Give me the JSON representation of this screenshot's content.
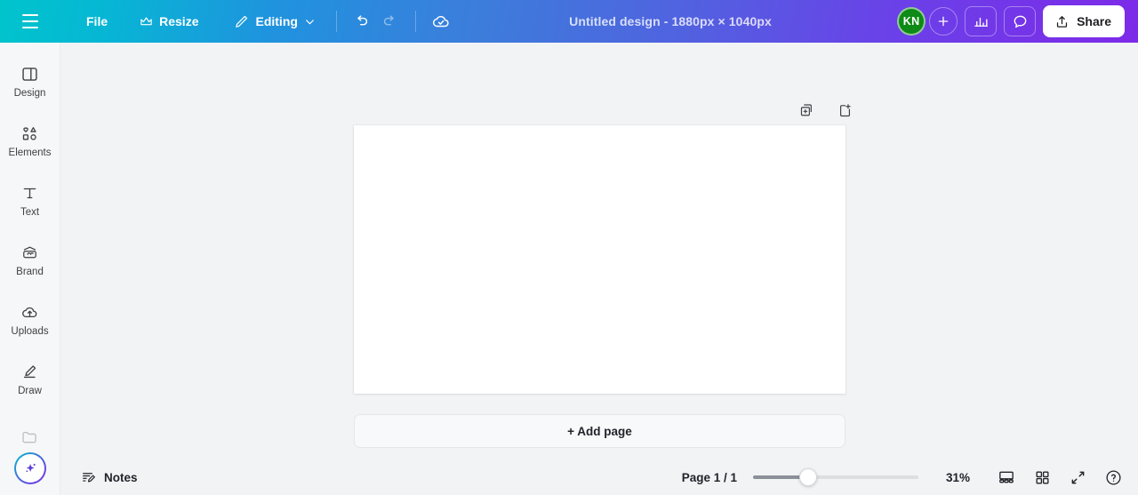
{
  "topbar": {
    "menu_icon": "hamburger-icon",
    "file_label": "File",
    "resize_label": "Resize",
    "resize_icon": "crown-icon",
    "editing_label": "Editing",
    "editing_icon": "pencil-icon",
    "editing_chevron": "chevron-down-icon",
    "undo_icon": "undo-icon",
    "redo_icon": "redo-icon",
    "saved_icon": "cloud-check-icon",
    "title": "Untitled design - 1880px × 1040px",
    "avatar_initials": "KN",
    "avatar_color": "#0e8a16",
    "add_collaborator_icon": "plus-icon",
    "insights_icon": "bar-chart-icon",
    "comments_icon": "comment-bubble-icon",
    "share_label": "Share",
    "share_icon": "upload-icon",
    "gradient_start": "#00c4cc",
    "gradient_mid": "#4272db",
    "gradient_end": "#7d2ae8"
  },
  "sidebar": {
    "items": [
      {
        "label": "Design",
        "icon": "design-panel-icon"
      },
      {
        "label": "Elements",
        "icon": "shapes-icon"
      },
      {
        "label": "Text",
        "icon": "text-t-icon"
      },
      {
        "label": "Brand",
        "icon": "brand-kit-icon"
      },
      {
        "label": "Uploads",
        "icon": "cloud-upload-icon"
      },
      {
        "label": "Draw",
        "icon": "draw-pencil-icon"
      },
      {
        "label": "",
        "icon": "folder-projects-icon"
      }
    ],
    "ai_button_icon": "magic-sparkle-icon"
  },
  "workspace": {
    "duplicate_page_icon": "duplicate-page-icon",
    "add_page_icon": "add-page-icon",
    "add_page_label": "+ Add page",
    "canvas_background": "#ffffff"
  },
  "bottombar": {
    "notes_label": "Notes",
    "notes_icon": "notes-pencil-icon",
    "page_count": "Page 1 / 1",
    "zoom_value": "31%",
    "zoom_percent": 31,
    "presenter_icon": "presenter-view-icon",
    "grid_icon": "grid-view-icon",
    "fullscreen_icon": "fullscreen-expand-icon",
    "help_icon": "help-question-icon"
  }
}
